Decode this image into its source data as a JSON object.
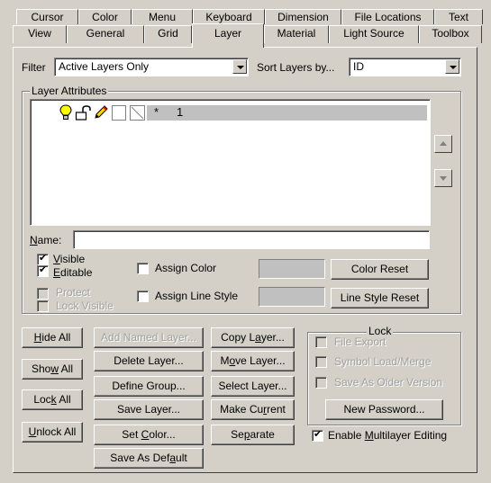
{
  "tabs_row1": [
    "Cursor",
    "Color",
    "Menu",
    "Keyboard",
    "Dimension",
    "File Locations",
    "Text"
  ],
  "tabs_row2": [
    "View",
    "General",
    "Grid",
    "Layer",
    "Material",
    "Light Source",
    "Toolbox"
  ],
  "active_tab": "Layer",
  "filter": {
    "label": "Filter",
    "value": "Active Layers Only"
  },
  "sort": {
    "label": "Sort Layers by...",
    "value": "ID"
  },
  "layer_attributes": {
    "title": "Layer Attributes",
    "rows": [
      {
        "marker": "*",
        "id": "1"
      }
    ]
  },
  "name": {
    "label": "Name:",
    "value": ""
  },
  "checks": {
    "visible": {
      "label": "Visible",
      "checked": true
    },
    "editable": {
      "label": "Editable",
      "checked": true
    },
    "protect": {
      "label": "Protect",
      "checked": false
    },
    "lock_visible": {
      "label": "Lock Visible",
      "checked": false
    },
    "assign_color": {
      "label": "Assign Color",
      "checked": false
    },
    "assign_line_style": {
      "label": "Assign Line Style",
      "checked": false
    }
  },
  "buttons": {
    "color_reset": "Color Reset",
    "line_style_reset": "Line Style Reset",
    "hide_all": "Hide All",
    "show_all": "Show All",
    "lock_all": "Lock All",
    "unlock_all": "Unlock All",
    "add_named_layer": "Add Named Layer...",
    "delete_layer": "Delete Layer...",
    "define_group": "Define Group...",
    "save_layer": "Save Layer...",
    "set_color": "Set Color...",
    "save_as_default": "Save As Default",
    "copy_layer": "Copy Layer...",
    "move_layer": "Move Layer...",
    "select_layer": "Select Layer...",
    "make_current": "Make Current",
    "separate": "Separate",
    "new_password": "New Password..."
  },
  "lock": {
    "title": "Lock",
    "file_export": "File Export",
    "symbol_load_merge": "Symbol Load/Merge",
    "save_as_older": "Save As Older Version"
  },
  "enable_multilayer": {
    "label": "Enable Multilayer Editing",
    "checked": true
  }
}
